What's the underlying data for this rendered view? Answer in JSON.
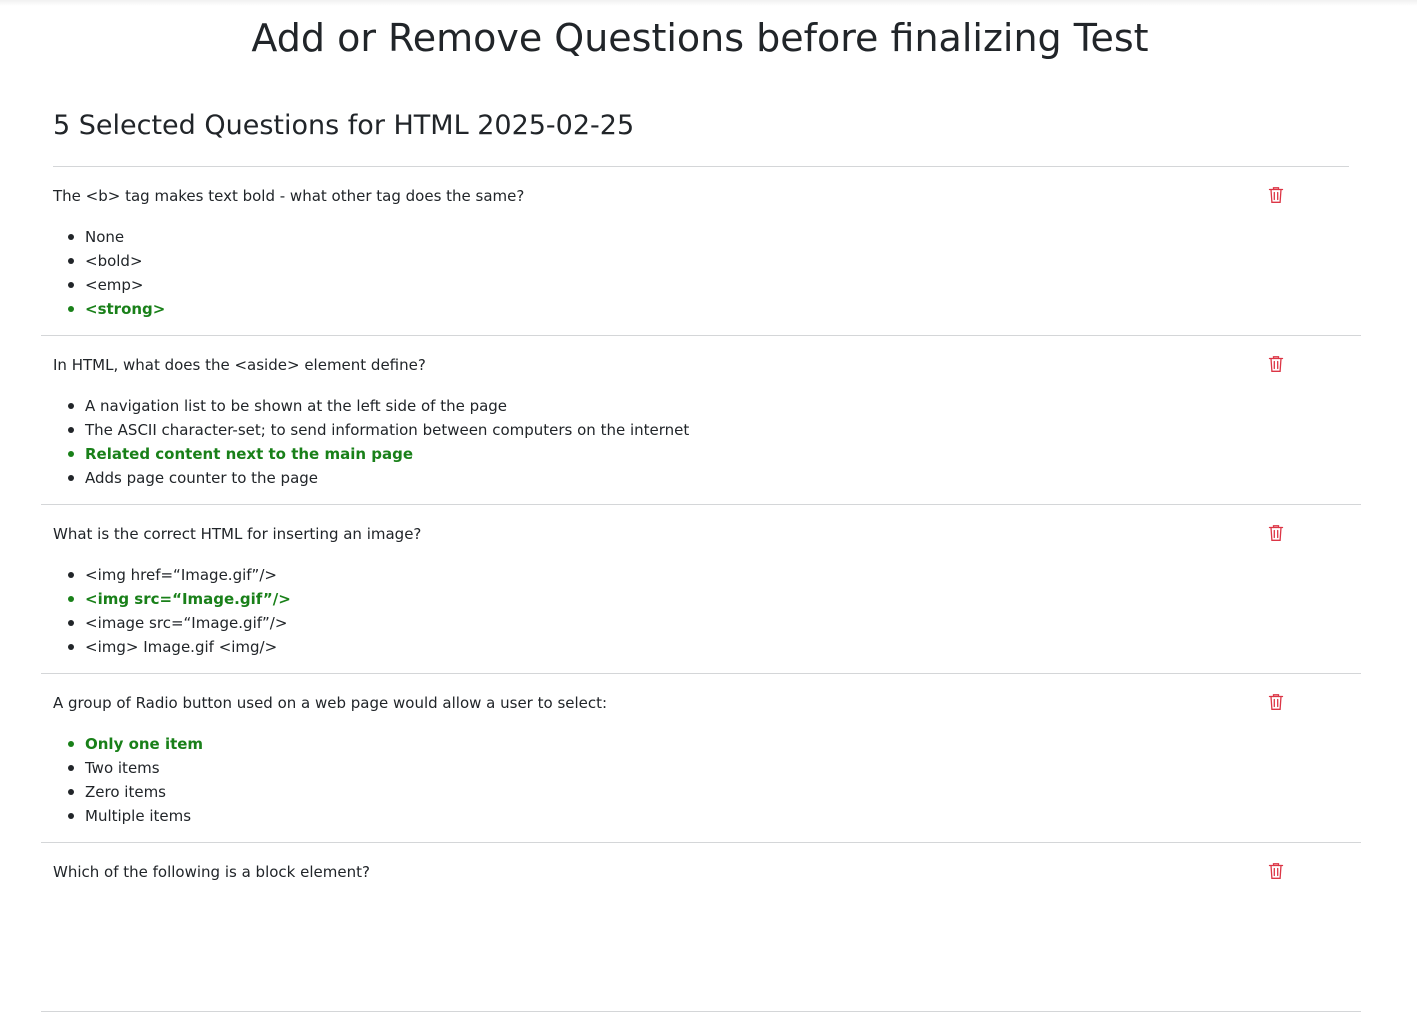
{
  "header": {
    "title": "Add or Remove Questions before finalizing Test"
  },
  "selection": {
    "heading": "5 Selected Questions for HTML 2025-02-25"
  },
  "colors": {
    "correct": "#198019",
    "delete": "#dc3545",
    "divider": "#d4d6d8"
  },
  "icons": {
    "delete": "trash-icon"
  },
  "questions": [
    {
      "text": "The <b> tag makes text bold - what other tag does the same?",
      "options": [
        {
          "label": "None",
          "correct": false
        },
        {
          "label": "<bold>",
          "correct": false
        },
        {
          "label": "<emp>",
          "correct": false
        },
        {
          "label": "<strong>",
          "correct": true
        }
      ]
    },
    {
      "text": "In HTML, what does the <aside> element define?",
      "options": [
        {
          "label": "A navigation list to be shown at the left side of the page",
          "correct": false
        },
        {
          "label": "The ASCII character-set; to send information between computers on the internet",
          "correct": false
        },
        {
          "label": "Related content next to the main page",
          "correct": true
        },
        {
          "label": "Adds page counter to the page",
          "correct": false
        }
      ]
    },
    {
      "text": "What is the correct HTML for inserting an image?",
      "options": [
        {
          "label": "<img href=“Image.gif”/>",
          "correct": false
        },
        {
          "label": "<img src=“Image.gif”/>",
          "correct": true
        },
        {
          "label": "<image src=“Image.gif”/>",
          "correct": false
        },
        {
          "label": "<img> Image.gif <img/>",
          "correct": false
        }
      ]
    },
    {
      "text": "A group of Radio button used on a web page would allow a user to select:",
      "options": [
        {
          "label": "Only one item",
          "correct": true
        },
        {
          "label": "Two items",
          "correct": false
        },
        {
          "label": "Zero items",
          "correct": false
        },
        {
          "label": "Multiple items",
          "correct": false
        }
      ]
    },
    {
      "text": "Which of the following is a block element?",
      "options": []
    }
  ]
}
